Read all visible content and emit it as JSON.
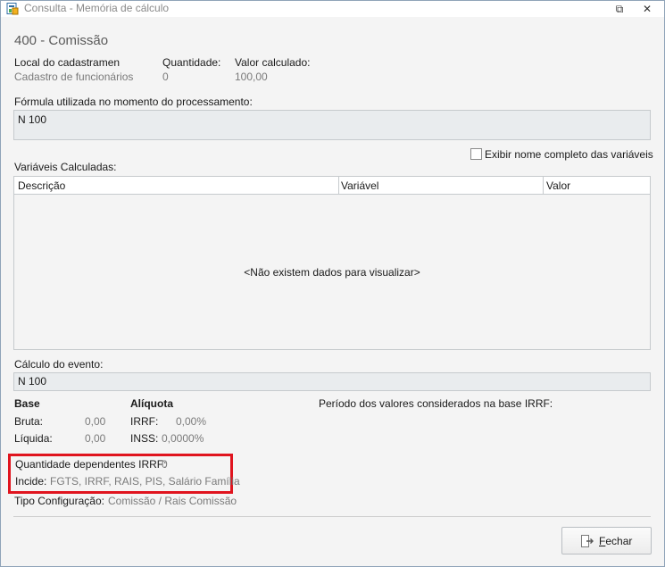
{
  "window": {
    "title": "Consulta - Memória de cálculo",
    "restore_glyph": "⧉",
    "close_glyph": "✕"
  },
  "header": {
    "event_title": "400 - Comissão",
    "local_label": "Local do cadastramen",
    "local_value": "Cadastro de funcionários",
    "quantidade_label": "Quantidade:",
    "quantidade_value": "0",
    "valor_label": "Valor calculado:",
    "valor_value": "100,00"
  },
  "formula": {
    "label": "Fórmula utilizada no momento do processamento:",
    "value": "N 100"
  },
  "options": {
    "show_full_names_label": "Exibir nome completo das variáveis",
    "show_full_names_checked": false
  },
  "variables": {
    "label": "Variáveis Calculadas:",
    "columns": [
      "Descrição",
      "Variável",
      "Valor"
    ],
    "empty_message": "<Não existem dados para visualizar>"
  },
  "calculo": {
    "label": "Cálculo do evento:",
    "value": "N 100"
  },
  "base": {
    "heading": "Base",
    "bruta_label": "Bruta:",
    "bruta_value": "0,00",
    "liquida_label": "Líquida:",
    "liquida_value": "0,00"
  },
  "aliquota": {
    "heading": "Alíquota",
    "irrf_label": "IRRF:",
    "irrf_value": "0,00%",
    "inss_label": "INSS:",
    "inss_value": "0,0000%"
  },
  "periodo": {
    "label": "Período dos valores considerados na base IRRF:"
  },
  "dependentes": {
    "label": "Quantidade dependentes IRRF:",
    "value": "0"
  },
  "incide": {
    "label": "Incide:",
    "value": "FGTS, IRRF, RAIS, PIS, Salário Família"
  },
  "tipo": {
    "label": "Tipo Configuração:",
    "value": "Comissão / Rais Comissão"
  },
  "footer": {
    "close_button_label_first": "F",
    "close_button_label_rest": "echar"
  },
  "colors": {
    "highlight_border": "#e0141e",
    "field_background": "#e9ecee"
  }
}
